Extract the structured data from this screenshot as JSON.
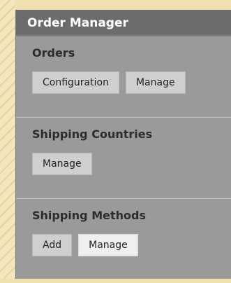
{
  "panel": {
    "title": "Order Manager",
    "sections": [
      {
        "title": "Orders",
        "buttons": [
          "Configuration",
          "Manage"
        ]
      },
      {
        "title": "Shipping Countries",
        "buttons": [
          "Manage"
        ]
      },
      {
        "title": "Shipping Methods",
        "buttons": [
          "Add",
          "Manage"
        ],
        "active_button": "Manage"
      }
    ]
  }
}
